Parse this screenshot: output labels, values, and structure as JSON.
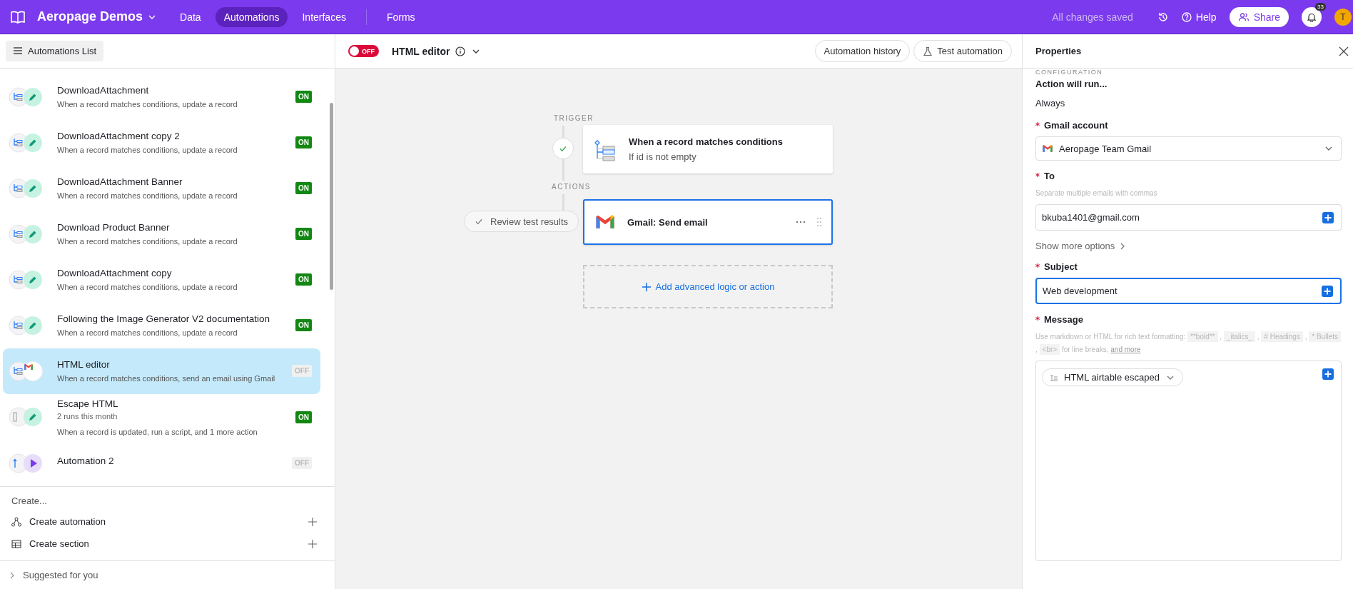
{
  "topbar": {
    "workspace": "Aeropage Demos",
    "nav": [
      {
        "label": "Data",
        "selected": false
      },
      {
        "label": "Automations",
        "selected": true
      },
      {
        "label": "Interfaces",
        "selected": false
      },
      {
        "label": "Forms",
        "selected": false
      }
    ],
    "save_status": "All changes saved",
    "help": "Help",
    "share": "Share",
    "notifications": "33",
    "avatar": "T"
  },
  "sidebar": {
    "header_button": "Automations List",
    "items": [
      {
        "kind": "update",
        "title": "DownloadAttachment",
        "description": "When a record matches conditions, update a record",
        "status": "ON",
        "on": true,
        "selected": false
      },
      {
        "kind": "update",
        "title": "DownloadAttachment copy 2",
        "description": "When a record matches conditions, update a record",
        "status": "ON",
        "on": true,
        "selected": false
      },
      {
        "kind": "update",
        "title": "DownloadAttachment Banner",
        "description": "When a record matches conditions, update a record",
        "status": "ON",
        "on": true,
        "selected": false
      },
      {
        "kind": "update",
        "title": "Download Product Banner",
        "description": "When a record matches conditions, update a record",
        "status": "ON",
        "on": true,
        "selected": false
      },
      {
        "kind": "update",
        "title": "DownloadAttachment copy",
        "description": "When a record matches conditions, update a record",
        "status": "ON",
        "on": true,
        "selected": false
      },
      {
        "kind": "update",
        "title": "Following the Image Generator V2 documentation",
        "description": "When a record matches conditions, update a record",
        "status": "ON",
        "on": true,
        "selected": false
      },
      {
        "kind": "email",
        "title": "HTML editor",
        "description": "When a record matches conditions, send an email using Gmail",
        "status": "OFF",
        "on": false,
        "selected": true
      },
      {
        "kind": "script",
        "title": "Escape HTML",
        "runs": "2 runs this month",
        "description": "When a record is updated, run a script, and 1 more action",
        "status": "ON",
        "on": true,
        "selected": false
      },
      {
        "kind": "manual",
        "title": "Automation 2",
        "status": "OFF",
        "on": false,
        "selected": false
      }
    ],
    "create_heading": "Create...",
    "create_items": [
      {
        "label": "Create automation",
        "kind": "automation"
      },
      {
        "label": "Create section",
        "kind": "section"
      }
    ],
    "suggested": "Suggested for you"
  },
  "editor": {
    "status": "OFF",
    "on": false,
    "title": "HTML editor",
    "buttons": [
      {
        "label": "Automation history",
        "kind": "plain"
      },
      {
        "label": "Test automation",
        "kind": "flask"
      }
    ],
    "trigger_label": "TRIGGER",
    "actions_label": "ACTIONS",
    "trigger": {
      "title": "When a record matches conditions",
      "subtitle": "If id is not empty"
    },
    "action": {
      "title": "Gmail: Send email",
      "selected": true
    },
    "review_button": "Review test results",
    "add_button": "Add advanced logic or action"
  },
  "properties": {
    "title": "Properties",
    "section": "CONFIGURATION",
    "run_label": "Action will run...",
    "run_value": "Always",
    "fields": [
      {
        "kind": "select",
        "label": "Gmail account",
        "required": true,
        "value": "Aeropage Team Gmail"
      },
      {
        "kind": "input",
        "label": "To",
        "required": true,
        "hint": [
          {
            "kind": "text",
            "text": "Separate multiple emails with commas"
          }
        ],
        "value": "bkuba1401@gmail.com",
        "focused": false
      },
      {
        "kind": "link",
        "label": "Show more options"
      },
      {
        "kind": "input",
        "label": "Subject",
        "required": true,
        "value": "Web development",
        "focused": true
      },
      {
        "kind": "rich",
        "label": "Message",
        "required": true,
        "hint": [
          {
            "kind": "text",
            "text": "Use markdown or HTML for rich text formatting: "
          },
          {
            "kind": "code",
            "text": "**bold**"
          },
          {
            "kind": "text",
            "text": " , "
          },
          {
            "kind": "code",
            "text": "_italics_"
          },
          {
            "kind": "text",
            "text": " , "
          },
          {
            "kind": "code",
            "text": "# Headings"
          },
          {
            "kind": "text",
            "text": " , "
          },
          {
            "kind": "code",
            "text": "* Bullets"
          },
          {
            "kind": "text",
            "text": " , "
          },
          {
            "kind": "code",
            "text": "<br>"
          },
          {
            "kind": "text",
            "text": " for line breaks, "
          },
          {
            "kind": "link",
            "text": "and more"
          }
        ],
        "token": "HTML airtable escaped"
      }
    ]
  }
}
